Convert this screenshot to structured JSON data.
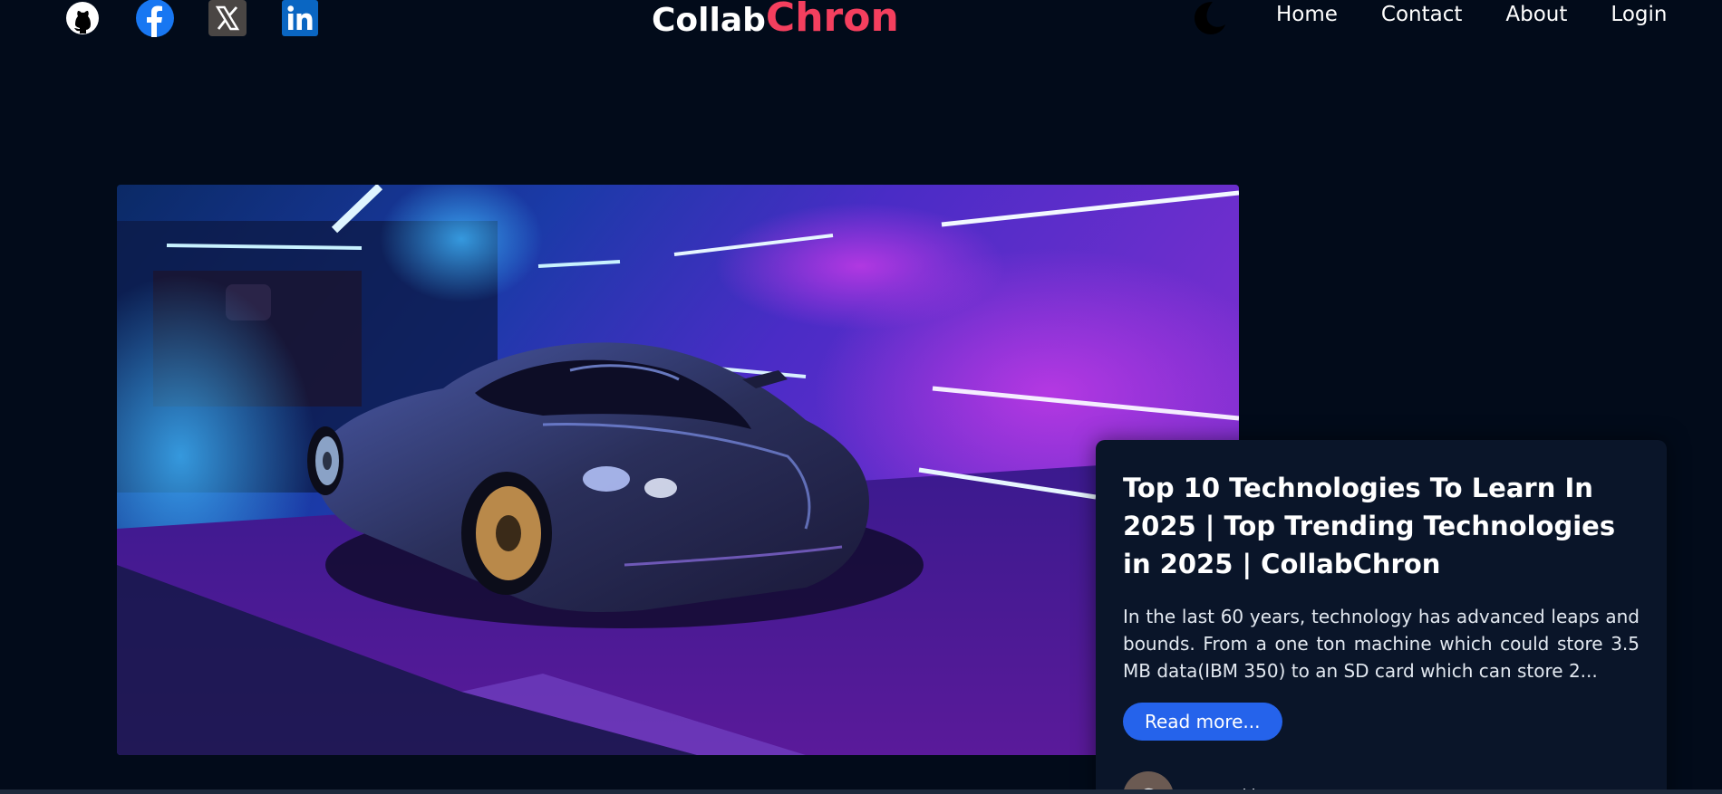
{
  "header": {
    "socials": [
      {
        "icon": "github-icon",
        "label": "GitHub"
      },
      {
        "icon": "facebook-icon",
        "label": "Facebook"
      },
      {
        "icon": "x-icon",
        "label": "X"
      },
      {
        "icon": "linkedin-icon",
        "label": "LinkedIn"
      }
    ],
    "logo": {
      "part1": "Collab",
      "part2": "Chron"
    },
    "theme_toggle_icon": "moon-icon",
    "nav": [
      {
        "label": "Home"
      },
      {
        "label": "Contact"
      },
      {
        "label": "About"
      },
      {
        "label": "Login"
      }
    ]
  },
  "featured_post": {
    "image_icon": "sports-car-image",
    "title": "Top 10 Technologies To Learn In 2025 | Top Trending Technologies in 2025 | CollabChron",
    "excerpt": "In the last 60 years, technology has advanced leaps and bounds. From a one ton machine which could store 3.5 MB data(IBM 350) to an SD card which can store 2...",
    "read_more_label": "Read more...",
    "author_initial": "C",
    "author_meta": "Posted by"
  },
  "colors": {
    "background": "#020b1a",
    "card_background": "#0a1529",
    "brand_accent": "#f43f5e",
    "button": "#2563eb",
    "facebook": "#1877f2",
    "linkedin": "#0a66c2"
  }
}
